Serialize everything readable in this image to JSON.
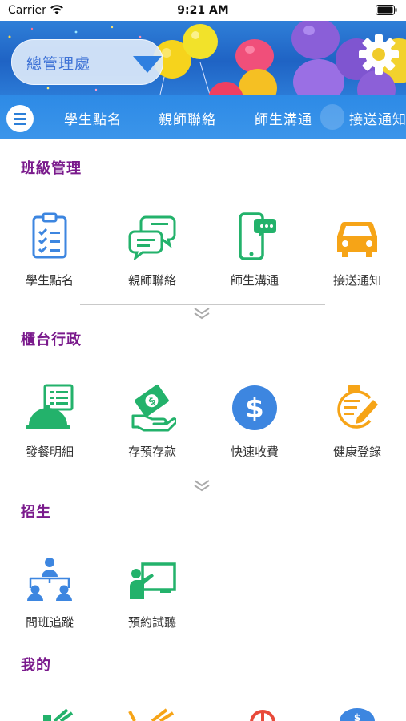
{
  "status": {
    "carrier": "Carrier",
    "time": "9:21 AM"
  },
  "header": {
    "office_select": "總管理處",
    "colors": {
      "banner": "#1f63c4",
      "tabbar": "#2d8ae6",
      "section_title": "#7a1a8c"
    }
  },
  "tabs": [
    {
      "label": "學生點名"
    },
    {
      "label": "親師聯絡"
    },
    {
      "label": "師生溝通"
    },
    {
      "label": "接送通知"
    }
  ],
  "sections": [
    {
      "title": "班級管理",
      "items": [
        {
          "label": "學生點名",
          "icon": "clipboard-checklist-icon",
          "color": "#3d86e0"
        },
        {
          "label": "親師聯絡",
          "icon": "chat-bubbles-icon",
          "color": "#23b26b"
        },
        {
          "label": "師生溝通",
          "icon": "phone-message-icon",
          "color": "#23b26b"
        },
        {
          "label": "接送通知",
          "icon": "car-icon",
          "color": "#f6a417"
        }
      ]
    },
    {
      "title": "櫃台行政",
      "items": [
        {
          "label": "發餐明細",
          "icon": "meal-cloche-icon",
          "color": "#23b26b"
        },
        {
          "label": "存預存款",
          "icon": "money-hand-icon",
          "color": "#23b26b"
        },
        {
          "label": "快速收費",
          "icon": "dollar-coin-icon",
          "color": "#3d86e0"
        },
        {
          "label": "健康登錄",
          "icon": "health-notepad-icon",
          "color": "#f6a417"
        }
      ]
    },
    {
      "title": "招生",
      "items": [
        {
          "label": "問班追蹤",
          "icon": "group-network-icon",
          "color": "#3d86e0"
        },
        {
          "label": "預約試聽",
          "icon": "teacher-board-icon",
          "color": "#23b26b"
        }
      ]
    },
    {
      "title": "我的",
      "items": []
    }
  ]
}
